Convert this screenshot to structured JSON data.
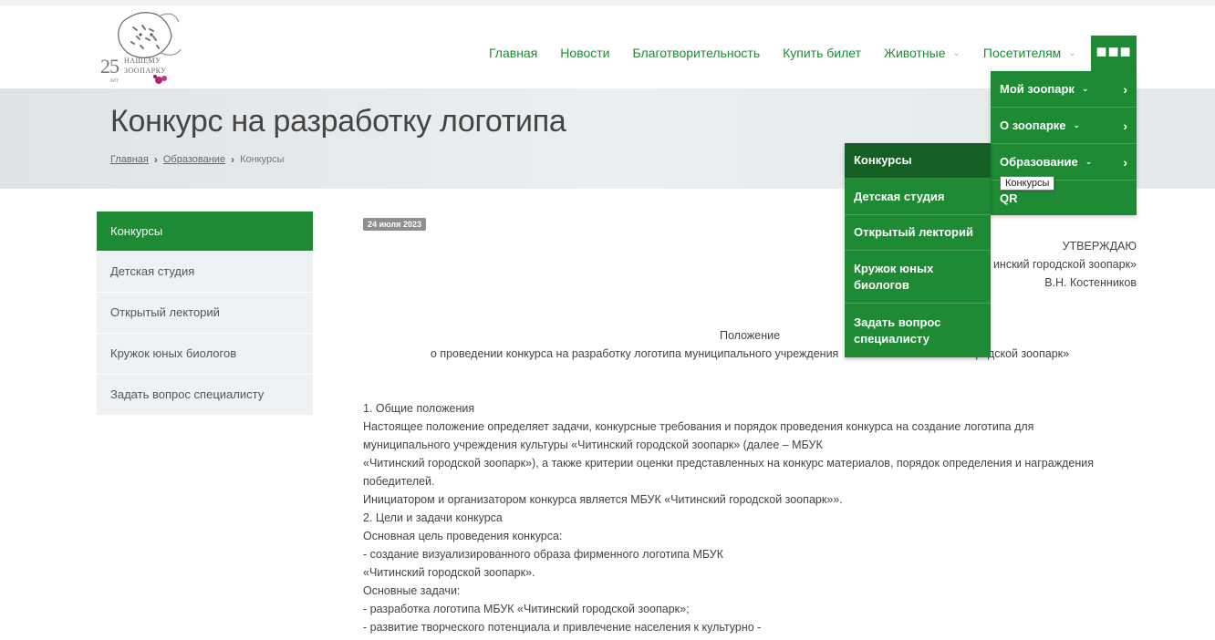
{
  "logo": {
    "number": "25",
    "line1": "НАШЕМУ",
    "line2": "ЗООПАРКУ",
    "line3": "лет"
  },
  "nav": {
    "items": [
      {
        "label": "Главная",
        "dropdown": false
      },
      {
        "label": "Новости",
        "dropdown": false
      },
      {
        "label": "Благотворительность",
        "dropdown": false
      },
      {
        "label": "Купить билет",
        "dropdown": false
      },
      {
        "label": "Животные",
        "dropdown": true
      },
      {
        "label": "Посетителям",
        "dropdown": true
      }
    ],
    "more_icon": "ellipsis-icon",
    "accent_color": "#1e8a34"
  },
  "page": {
    "title": "Конкурс на разработку логотипа",
    "breadcrumb": [
      "Главная",
      "Образование",
      "Конкурсы"
    ]
  },
  "sidebar": {
    "items": [
      "Конкурсы",
      "Детская студия",
      "Открытый лекторий",
      "Кружок юных биологов",
      "Задать вопрос специалисту"
    ],
    "active": "Конкурсы"
  },
  "article": {
    "date": "24 июля 2023",
    "approve_line1": "УТВЕРЖДАЮ",
    "approve_line2": "инский городской зоопарк»",
    "approve_line3": "В.Н. Костенников",
    "heading1": "Положение",
    "heading2": "о проведении конкурса на разработку логотипа муниципального учреждения",
    "heading2_tail": "родской зоопарк»",
    "paragraphs": [
      "1. Общие положения",
      "Настоящее положение определяет задачи, конкурсные требования и порядок проведения конкурса на создание логотипа для",
      "муниципального учреждения культуры «Читинский городской зоопарк» (далее – МБУК",
      "«Читинский городской зоопарк»), а также критерии оценки представленных на конкурс материалов, порядок определения и награждения",
      "победителей.",
      "Инициатором и организатором конкурса является МБУК «Читинский городской зоопарк»».",
      "2. Цели и задачи конкурса",
      "Основная цель проведения конкурса:",
      "- создание визуализированного образа фирменного логотипа МБУК",
      "«Читинский городской зоопарк».",
      "Основные задачи:",
      "- разработка логотипа МБУК «Читинский городской зоопарк»;",
      "- развитие творческого потенциала и привлечение населения к культурно -"
    ]
  },
  "dropdown_main": {
    "items": [
      "Мой зоопарк",
      "О зоопарке",
      "Образование",
      "QR"
    ]
  },
  "dropdown_sub": {
    "items": [
      "Конкурсы",
      "Детская студия",
      "Открытый лекторий",
      "Кружок юных биологов",
      "Задать вопрос специалисту"
    ],
    "active": "Конкурсы"
  },
  "tooltip": {
    "text": "Конкурсы"
  }
}
